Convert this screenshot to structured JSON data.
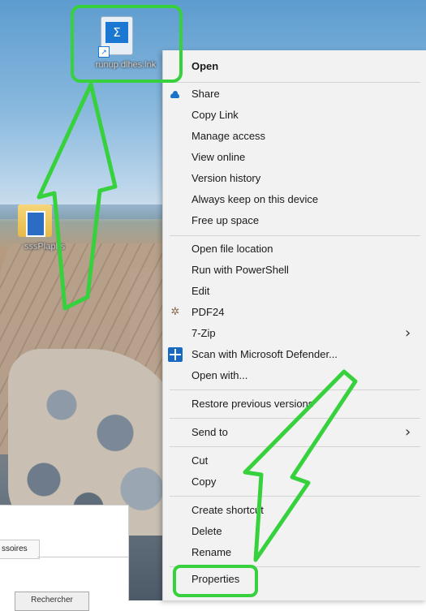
{
  "desktop": {
    "shortcut_icon": {
      "label": "runup dlhes.lnk",
      "glyph": "Σ"
    },
    "folder_icon": {
      "label": "sssPlaphs"
    }
  },
  "background_window": {
    "tab_label": "ssoires",
    "button_label": "Rechercher"
  },
  "context_menu": {
    "items": [
      {
        "label": "Open",
        "bold": true
      },
      {
        "label": "Share",
        "icon": "onedrive-cloud-icon"
      },
      {
        "label": "Copy Link"
      },
      {
        "label": "Manage access"
      },
      {
        "label": "View online"
      },
      {
        "label": "Version history"
      },
      {
        "label": "Always keep on this device"
      },
      {
        "label": "Free up space"
      },
      {
        "label": "Open file location"
      },
      {
        "label": "Run with PowerShell"
      },
      {
        "label": "Edit"
      },
      {
        "label": "PDF24",
        "icon": "pdf24-icon"
      },
      {
        "label": "7-Zip",
        "submenu": true
      },
      {
        "label": "Scan with Microsoft Defender...",
        "icon": "defender-shield-icon"
      },
      {
        "label": "Open with..."
      },
      {
        "label": "Restore previous versions"
      },
      {
        "label": "Send to",
        "submenu": true
      },
      {
        "label": "Cut"
      },
      {
        "label": "Copy"
      },
      {
        "label": "Create shortcut"
      },
      {
        "label": "Delete"
      },
      {
        "label": "Rename"
      },
      {
        "label": "Properties"
      }
    ]
  },
  "annotation": {
    "color": "#36d13d"
  }
}
